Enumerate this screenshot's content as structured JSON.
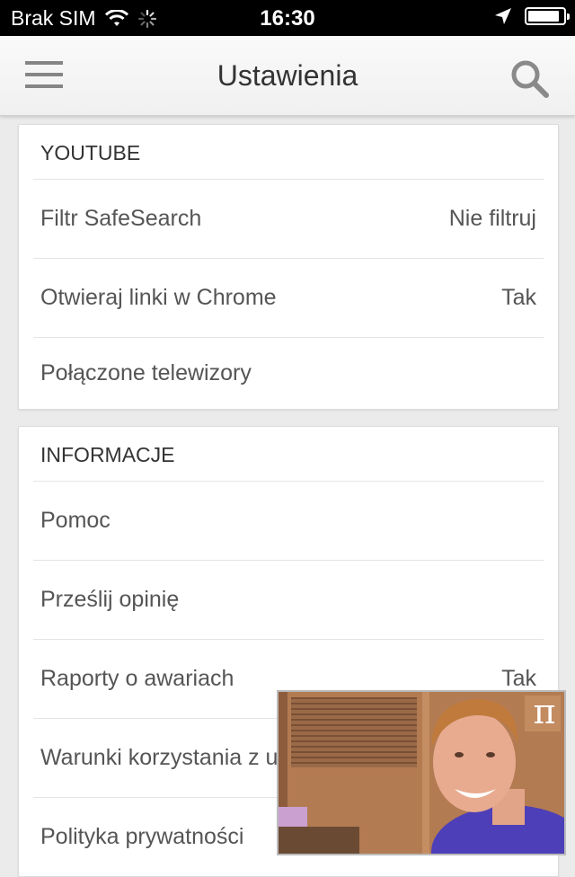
{
  "status_bar": {
    "carrier": "Brak SIM",
    "time": "16:30",
    "battery_level": 0.9
  },
  "app_bar": {
    "title": "Ustawienia",
    "menu_icon": "hamburger-menu-icon",
    "search_icon": "search-icon"
  },
  "sections": [
    {
      "header": "YOUTUBE",
      "rows": [
        {
          "label": "Filtr SafeSearch",
          "value": "Nie filtruj"
        },
        {
          "label": "Otwieraj linki w Chrome",
          "value": "Tak"
        },
        {
          "label": "Połączone telewizory",
          "value": ""
        }
      ]
    },
    {
      "header": "INFORMACJE",
      "rows": [
        {
          "label": "Pomoc",
          "value": ""
        },
        {
          "label": "Prześlij opinię",
          "value": ""
        },
        {
          "label": "Raporty o awariach",
          "value": "Tak"
        },
        {
          "label": "Warunki korzystania z usługi",
          "value": ""
        },
        {
          "label": "Polityka prywatności",
          "value": ""
        }
      ]
    }
  ],
  "pip_overlay": {
    "badge": "π"
  },
  "colors": {
    "status_bar_bg": "#000000",
    "app_bar_bg": "#f5f5f5",
    "page_bg": "#ebebeb",
    "text": "#555555"
  }
}
